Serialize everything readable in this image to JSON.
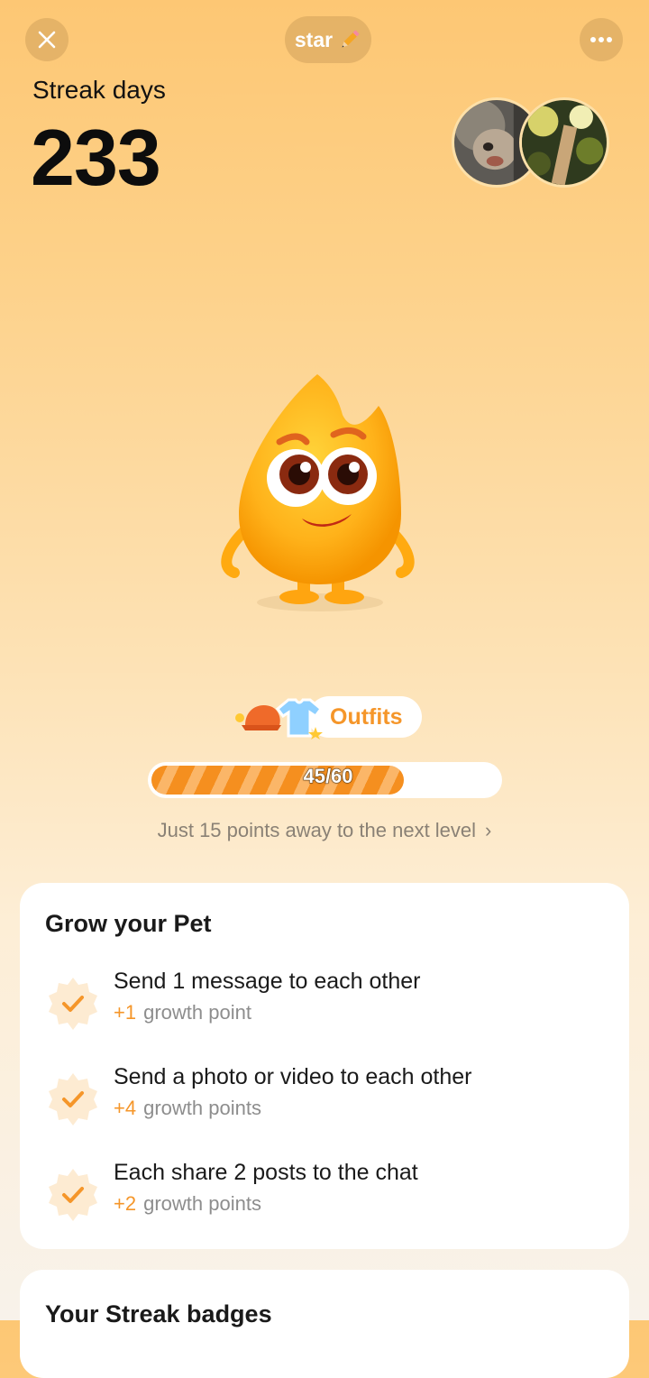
{
  "header": {
    "name": "star",
    "close_icon": "close-icon",
    "edit_icon": "pencil-icon",
    "more_icon": "more-dots-icon"
  },
  "streak": {
    "label": "Streak days",
    "value": "233"
  },
  "outfits": {
    "label": "Outfits"
  },
  "progress": {
    "current": 45,
    "total": 60,
    "text": "45/60",
    "next_level_text": "Just 15 points away to the next level"
  },
  "grow_card": {
    "title": "Grow your Pet",
    "tasks": [
      {
        "title": "Send 1 message to each other",
        "plus": "+1",
        "unit": "growth point"
      },
      {
        "title": "Send a photo or video to each other",
        "plus": "+4",
        "unit": "growth points"
      },
      {
        "title": "Each share 2 posts to the chat",
        "plus": "+2",
        "unit": "growth points"
      }
    ]
  },
  "badges_card": {
    "title": "Your Streak badges"
  },
  "colors": {
    "accent": "#f5962a",
    "background_top": "#fdc774",
    "card": "#ffffff"
  }
}
